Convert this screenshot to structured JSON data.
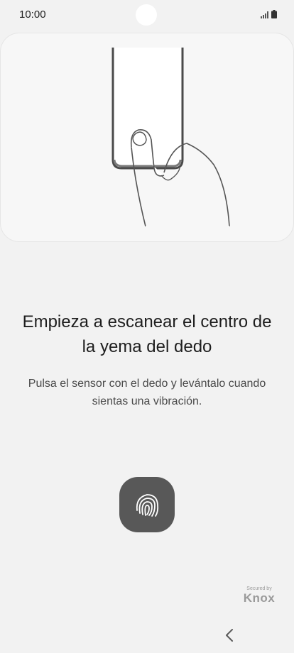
{
  "status_bar": {
    "time": "10:00",
    "icons": [
      "signal-icon",
      "battery-icon"
    ]
  },
  "illustration": {
    "icon": "finger-on-phone-illustration"
  },
  "headline": "Empieza a escanear el centro de la yema del dedo",
  "description": "Pulsa el sensor con el dedo y levántalo cuando sientas una vibración.",
  "sensor": {
    "icon": "fingerprint-icon",
    "background_color": "#585858"
  },
  "knox": {
    "top_label": "Secured by",
    "brand": "Knox"
  },
  "navigation": {
    "back_icon": "chevron-left-icon"
  }
}
